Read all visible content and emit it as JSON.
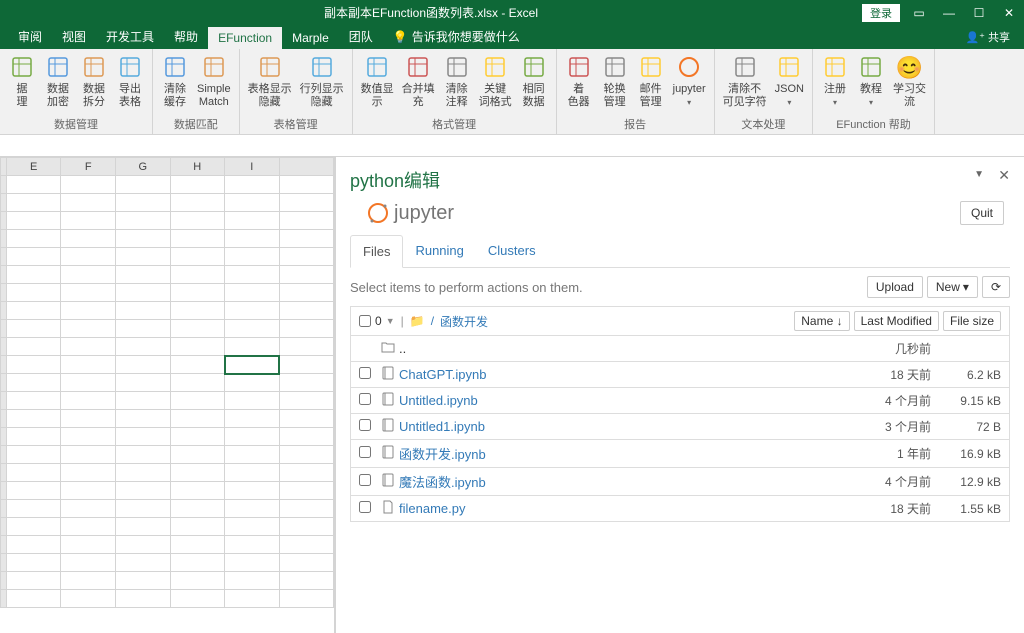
{
  "title": "副本副本EFunction函数列表.xlsx - Excel",
  "login": "登录",
  "share": "共享",
  "tabs": [
    "审阅",
    "视图",
    "开发工具",
    "帮助",
    "EFunction",
    "Marple",
    "团队"
  ],
  "active_tab": "EFunction",
  "tellme": "告诉我你想要做什么",
  "ribbon": {
    "g1": {
      "label": "数据管理",
      "btns": [
        {
          "l1": "据",
          "l2": "理"
        },
        {
          "l1": "数据",
          "l2": "加密"
        },
        {
          "l1": "数据",
          "l2": "拆分"
        },
        {
          "l1": "导出",
          "l2": "表格"
        }
      ]
    },
    "g2": {
      "label": "数据匹配",
      "btns": [
        {
          "l1": "清除",
          "l2": "缓存"
        },
        {
          "l1": "Simple",
          "l2": "Match"
        }
      ]
    },
    "g3": {
      "label": "表格管理",
      "btns": [
        {
          "l1": "表格显示",
          "l2": "隐藏"
        },
        {
          "l1": "行列显示",
          "l2": "隐藏"
        }
      ]
    },
    "g4": {
      "label": "格式管理",
      "btns": [
        {
          "l1": "数值显",
          "l2": "示"
        },
        {
          "l1": "合并填",
          "l2": "充"
        },
        {
          "l1": "清除",
          "l2": "注释"
        },
        {
          "l1": "关键",
          "l2": "词格式"
        },
        {
          "l1": "相同",
          "l2": "数据"
        }
      ]
    },
    "g5": {
      "label": "报告",
      "btns": [
        {
          "l1": "着",
          "l2": "色器"
        },
        {
          "l1": "轮换",
          "l2": "管理"
        },
        {
          "l1": "邮件",
          "l2": "管理"
        },
        {
          "l1": "jupyter",
          "l2": ""
        }
      ]
    },
    "g6": {
      "label": "文本处理",
      "btns": [
        {
          "l1": "清除不",
          "l2": "可见字符"
        },
        {
          "l1": "JSON",
          "l2": ""
        }
      ]
    },
    "g7": {
      "label": "EFunction 帮助",
      "btns": [
        {
          "l1": "注册",
          "l2": ""
        },
        {
          "l1": "教程",
          "l2": ""
        },
        {
          "l1": "学习交",
          "l2": "流"
        }
      ]
    }
  },
  "cols": [
    "E",
    "F",
    "G",
    "H",
    "I",
    ""
  ],
  "panel": {
    "title": "python编辑",
    "jupyter": "jupyter",
    "quit": "Quit",
    "tabs": [
      "Files",
      "Running",
      "Clusters"
    ],
    "hint": "Select items to perform actions on them.",
    "upload": "Upload",
    "new": "New",
    "zero": "0",
    "crumb_folder": "函数开发",
    "head_name": "Name",
    "head_mod": "Last Modified",
    "head_size": "File size",
    "rows": [
      {
        "icon": "folder",
        "name": "..",
        "mod": "几秒前",
        "size": "",
        "link": false
      },
      {
        "icon": "book",
        "name": "ChatGPT.ipynb",
        "mod": "18 天前",
        "size": "6.2 kB",
        "link": true
      },
      {
        "icon": "book",
        "name": "Untitled.ipynb",
        "mod": "4 个月前",
        "size": "9.15 kB",
        "link": true
      },
      {
        "icon": "book",
        "name": "Untitled1.ipynb",
        "mod": "3 个月前",
        "size": "72 B",
        "link": true
      },
      {
        "icon": "book",
        "name": "函数开发.ipynb",
        "mod": "1 年前",
        "size": "16.9 kB",
        "link": true
      },
      {
        "icon": "book",
        "name": "魔法函数.ipynb",
        "mod": "4 个月前",
        "size": "12.9 kB",
        "link": true
      },
      {
        "icon": "file",
        "name": "filename.py",
        "mod": "18 天前",
        "size": "1.55 kB",
        "link": true
      }
    ]
  }
}
